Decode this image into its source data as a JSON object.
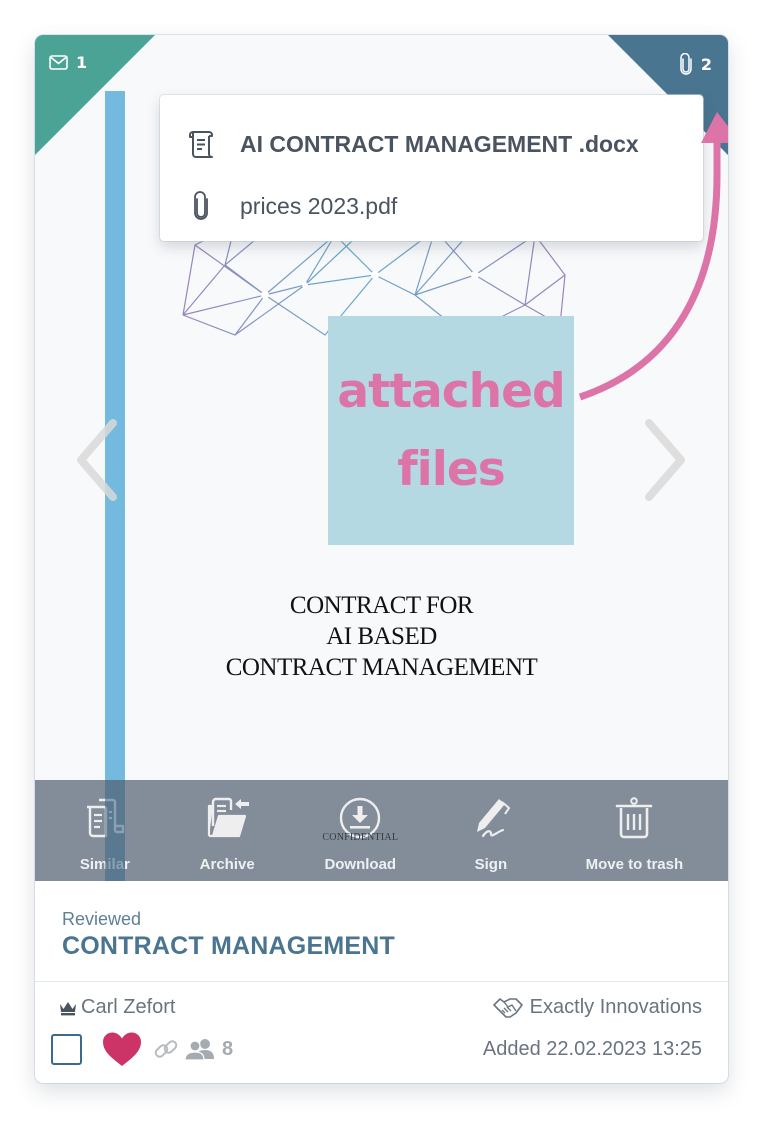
{
  "badges": {
    "messages": {
      "icon": "envelope-icon",
      "count": "1",
      "color": "#4aa394"
    },
    "attachments": {
      "icon": "paperclip-icon",
      "count": "2",
      "color": "#4a7590"
    }
  },
  "popup": {
    "items": [
      {
        "icon": "scroll-document-icon",
        "label": "AI CONTRACT MANAGEMENT .docx",
        "bold": true
      },
      {
        "icon": "paperclip-icon",
        "label": "prices 2023.pdf",
        "bold": false
      }
    ]
  },
  "preview": {
    "document_title_lines": [
      "CONTRACT FOR",
      "AI BASED",
      "CONTRACT MANAGEMENT"
    ],
    "annotation": {
      "lines": [
        "attached",
        "files"
      ],
      "text_color": "#dd74a8",
      "box_color": "#b4d9e2"
    },
    "watermark": "CONFIDENTIAL"
  },
  "actions": [
    {
      "icon": "similar-documents-icon",
      "label": "Similar"
    },
    {
      "icon": "archive-folder-icon",
      "label": "Archive"
    },
    {
      "icon": "download-icon",
      "label": "Download"
    },
    {
      "icon": "sign-pen-icon",
      "label": "Sign"
    },
    {
      "icon": "trash-icon",
      "label": "Move to trash"
    }
  ],
  "info": {
    "status": "Reviewed",
    "title": "CONTRACT MANAGEMENT"
  },
  "meta": {
    "owner": "Carl Zefort",
    "company": "Exactly Innovations",
    "added": "Added 22.02.2023 13:25",
    "shared_count": "8",
    "favorite": true,
    "selected": false,
    "heart_color": "#cc3366"
  }
}
